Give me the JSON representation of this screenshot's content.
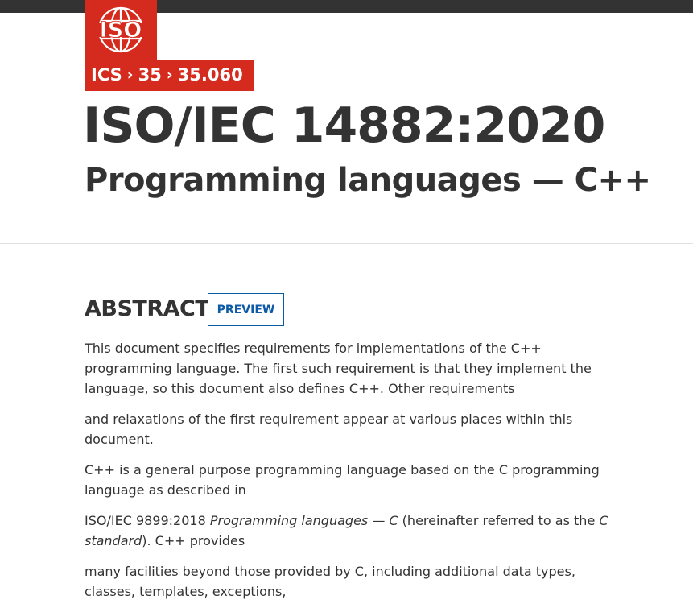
{
  "brand": {
    "logo_text": "ISO",
    "colors": {
      "brand_red": "#d52b1e",
      "top_bar": "#333333",
      "link_blue": "#0d5aa7",
      "text": "#333333"
    }
  },
  "breadcrumb": {
    "items": [
      "ICS",
      "35",
      "35.060"
    ],
    "separator": "›"
  },
  "header": {
    "title": "ISO/IEC 14882:2020",
    "subtitle": "Programming languages — C++"
  },
  "abstract": {
    "heading": "ABSTRACT",
    "preview_label": "PREVIEW",
    "paragraphs": {
      "p1": "This document specifies requirements for implementations of the C++ programming language. The first such requirement is that they implement the language, so this document also defines C++. Other requirements",
      "p2": "and relaxations of the first requirement appear at various places within this document.",
      "p3": "C++ is a general purpose programming language based on the C programming language as described in",
      "p4": {
        "part1": "ISO/IEC 9899:2018 ",
        "part2": "Programming languages — C",
        "part3": " (hereinafter referred to as the ",
        "part4": "C standard",
        "part5": "). C++ provides"
      },
      "p5": "many facilities beyond those provided by C, including additional data types, classes, templates, exceptions,"
    }
  }
}
